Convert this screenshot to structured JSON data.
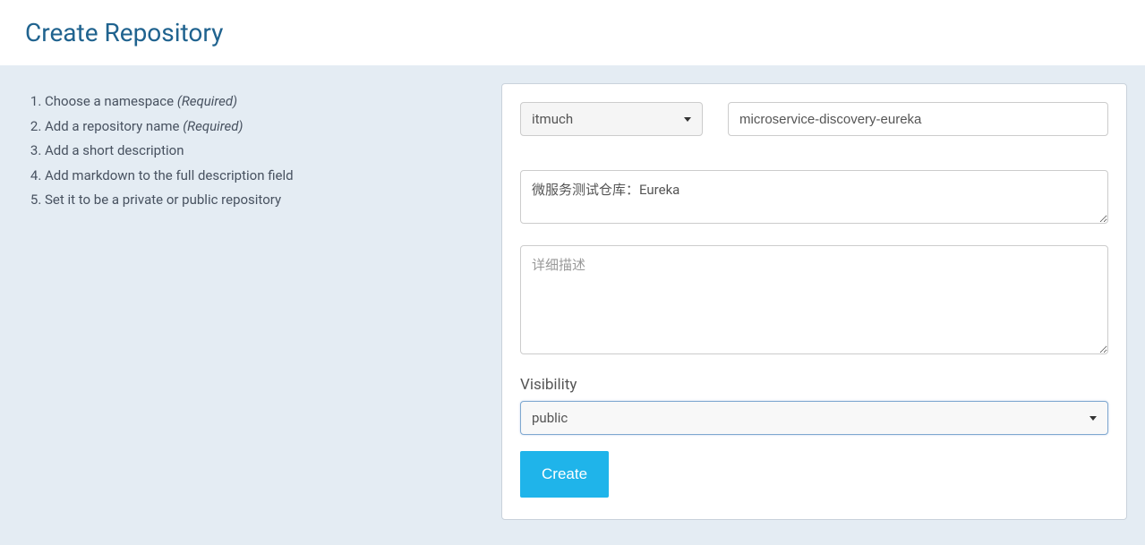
{
  "header": {
    "title": "Create Repository"
  },
  "steps": {
    "items": [
      {
        "text": "Choose a namespace ",
        "required_label": "(Required)"
      },
      {
        "text": "Add a repository name ",
        "required_label": "(Required)"
      },
      {
        "text": "Add a short description",
        "required_label": ""
      },
      {
        "text": "Add markdown to the full description field",
        "required_label": ""
      },
      {
        "text": "Set it to be a private or public repository",
        "required_label": ""
      }
    ]
  },
  "form": {
    "namespace": {
      "selected": "itmuch"
    },
    "repo_name": {
      "value": "microservice-discovery-eureka"
    },
    "short_description": {
      "value": "微服务测试仓库：Eureka"
    },
    "full_description": {
      "placeholder": "详细描述",
      "value": ""
    },
    "visibility": {
      "label": "Visibility",
      "selected": "public"
    },
    "submit": {
      "label": "Create"
    }
  }
}
